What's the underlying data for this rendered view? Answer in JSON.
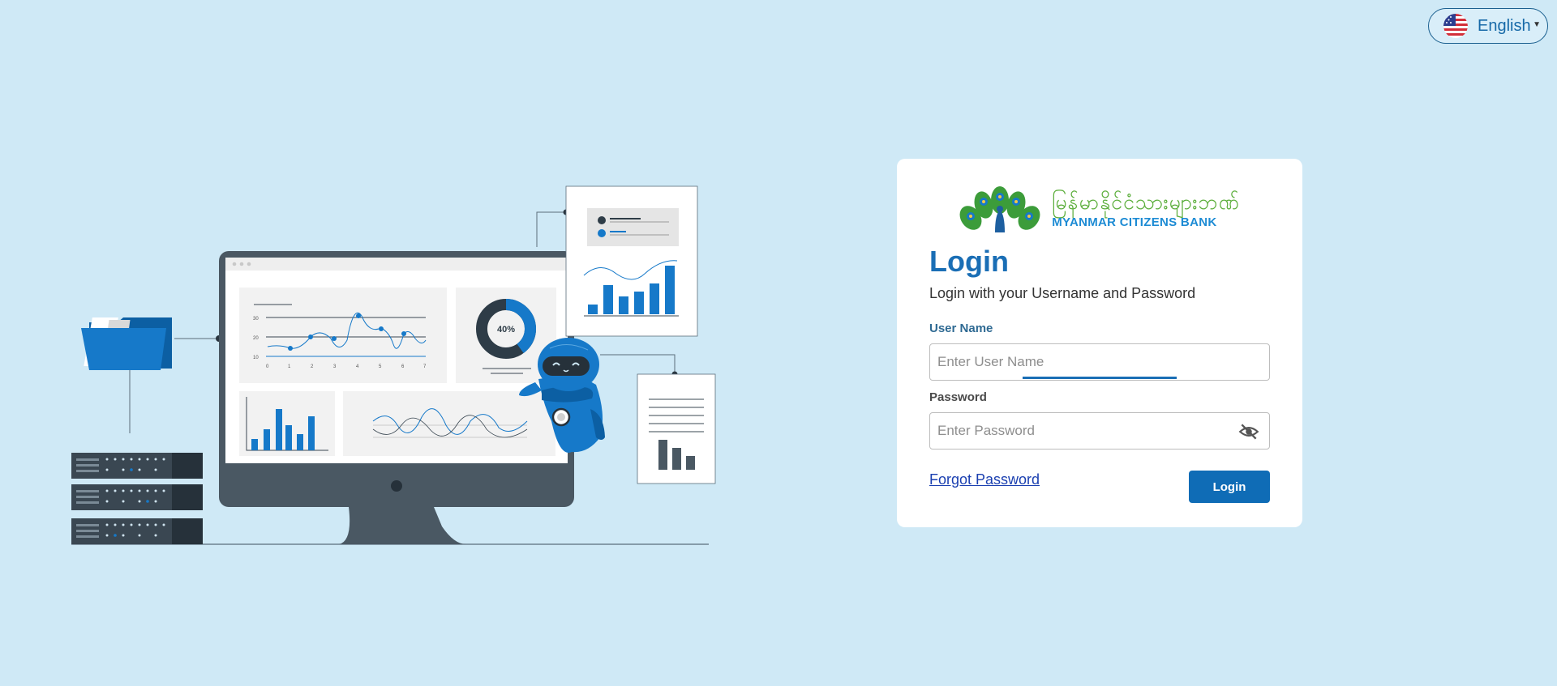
{
  "language": {
    "label": "English",
    "flag_icon": "us-flag-icon"
  },
  "logo": {
    "myanmar_text": "မြန်မာနိုင်ငံသားများဘဏ်",
    "english_text": "MYANMAR CITIZENS BANK"
  },
  "login": {
    "title": "Login",
    "subtitle": "Login with your Username and Password",
    "username_label": "User Name",
    "username_placeholder": "Enter User Name",
    "username_value": "",
    "password_label": "Password",
    "password_placeholder": "Enter Password",
    "password_value": "",
    "forgot_label": "Forgot Password",
    "login_button_label": "Login"
  },
  "illustration": {
    "donut_label": "40%",
    "donut_percent": 40,
    "line_chart_y_ticks": [
      "30",
      "20",
      "10"
    ],
    "line_chart_x_ticks": [
      "0",
      "1",
      "2",
      "3",
      "4",
      "5",
      "6",
      "7"
    ]
  },
  "colors": {
    "background": "#cfe9f6",
    "primary": "#1a6eb5",
    "button": "#0f6cb6",
    "link": "#1a3fb0"
  }
}
